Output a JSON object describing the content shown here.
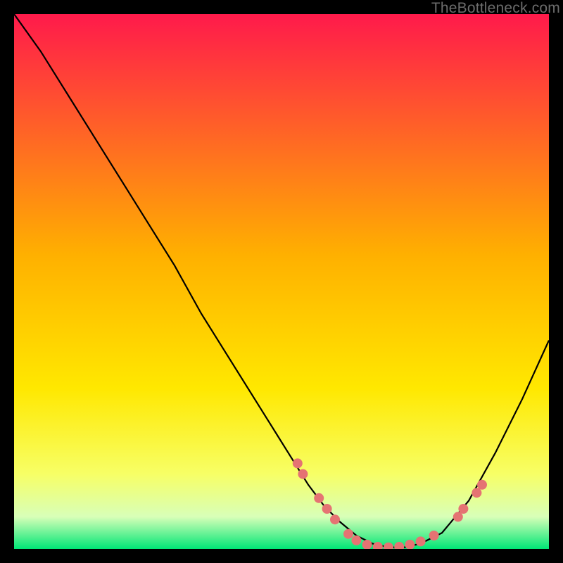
{
  "watermark": "TheBottleneck.com",
  "chart_data": {
    "type": "line",
    "title": "",
    "xlabel": "",
    "ylabel": "",
    "xlim": [
      0,
      100
    ],
    "ylim": [
      0,
      100
    ],
    "background_gradient": {
      "stops": [
        {
          "offset": 0.0,
          "color": "#ff1a4b"
        },
        {
          "offset": 0.45,
          "color": "#ffb000"
        },
        {
          "offset": 0.7,
          "color": "#ffe800"
        },
        {
          "offset": 0.86,
          "color": "#f7ff66"
        },
        {
          "offset": 0.94,
          "color": "#d8ffb8"
        },
        {
          "offset": 1.0,
          "color": "#00e676"
        }
      ]
    },
    "series": [
      {
        "name": "bottleneck-curve",
        "color": "#000000",
        "x": [
          0,
          5,
          10,
          15,
          20,
          25,
          30,
          35,
          40,
          45,
          50,
          55,
          58,
          61,
          64,
          67,
          70,
          73,
          76,
          80,
          85,
          90,
          95,
          100
        ],
        "y": [
          100,
          93,
          85,
          77,
          69,
          61,
          53,
          44,
          36,
          28,
          20,
          12,
          8,
          5,
          2.5,
          1,
          0.3,
          0.3,
          1,
          3,
          9,
          18,
          28,
          39
        ]
      }
    ],
    "markers": {
      "name": "highlight-dots",
      "color": "#e57373",
      "radius": 7,
      "points": [
        {
          "x": 53,
          "y": 16
        },
        {
          "x": 54,
          "y": 14
        },
        {
          "x": 57,
          "y": 9.5
        },
        {
          "x": 58.5,
          "y": 7.5
        },
        {
          "x": 60,
          "y": 5.5
        },
        {
          "x": 62.5,
          "y": 2.8
        },
        {
          "x": 64,
          "y": 1.6
        },
        {
          "x": 66,
          "y": 0.8
        },
        {
          "x": 68,
          "y": 0.4
        },
        {
          "x": 70,
          "y": 0.3
        },
        {
          "x": 72,
          "y": 0.4
        },
        {
          "x": 74,
          "y": 0.8
        },
        {
          "x": 76,
          "y": 1.4
        },
        {
          "x": 78.5,
          "y": 2.5
        },
        {
          "x": 83,
          "y": 6
        },
        {
          "x": 84,
          "y": 7.5
        },
        {
          "x": 86.5,
          "y": 10.5
        },
        {
          "x": 87.5,
          "y": 12
        }
      ]
    }
  }
}
